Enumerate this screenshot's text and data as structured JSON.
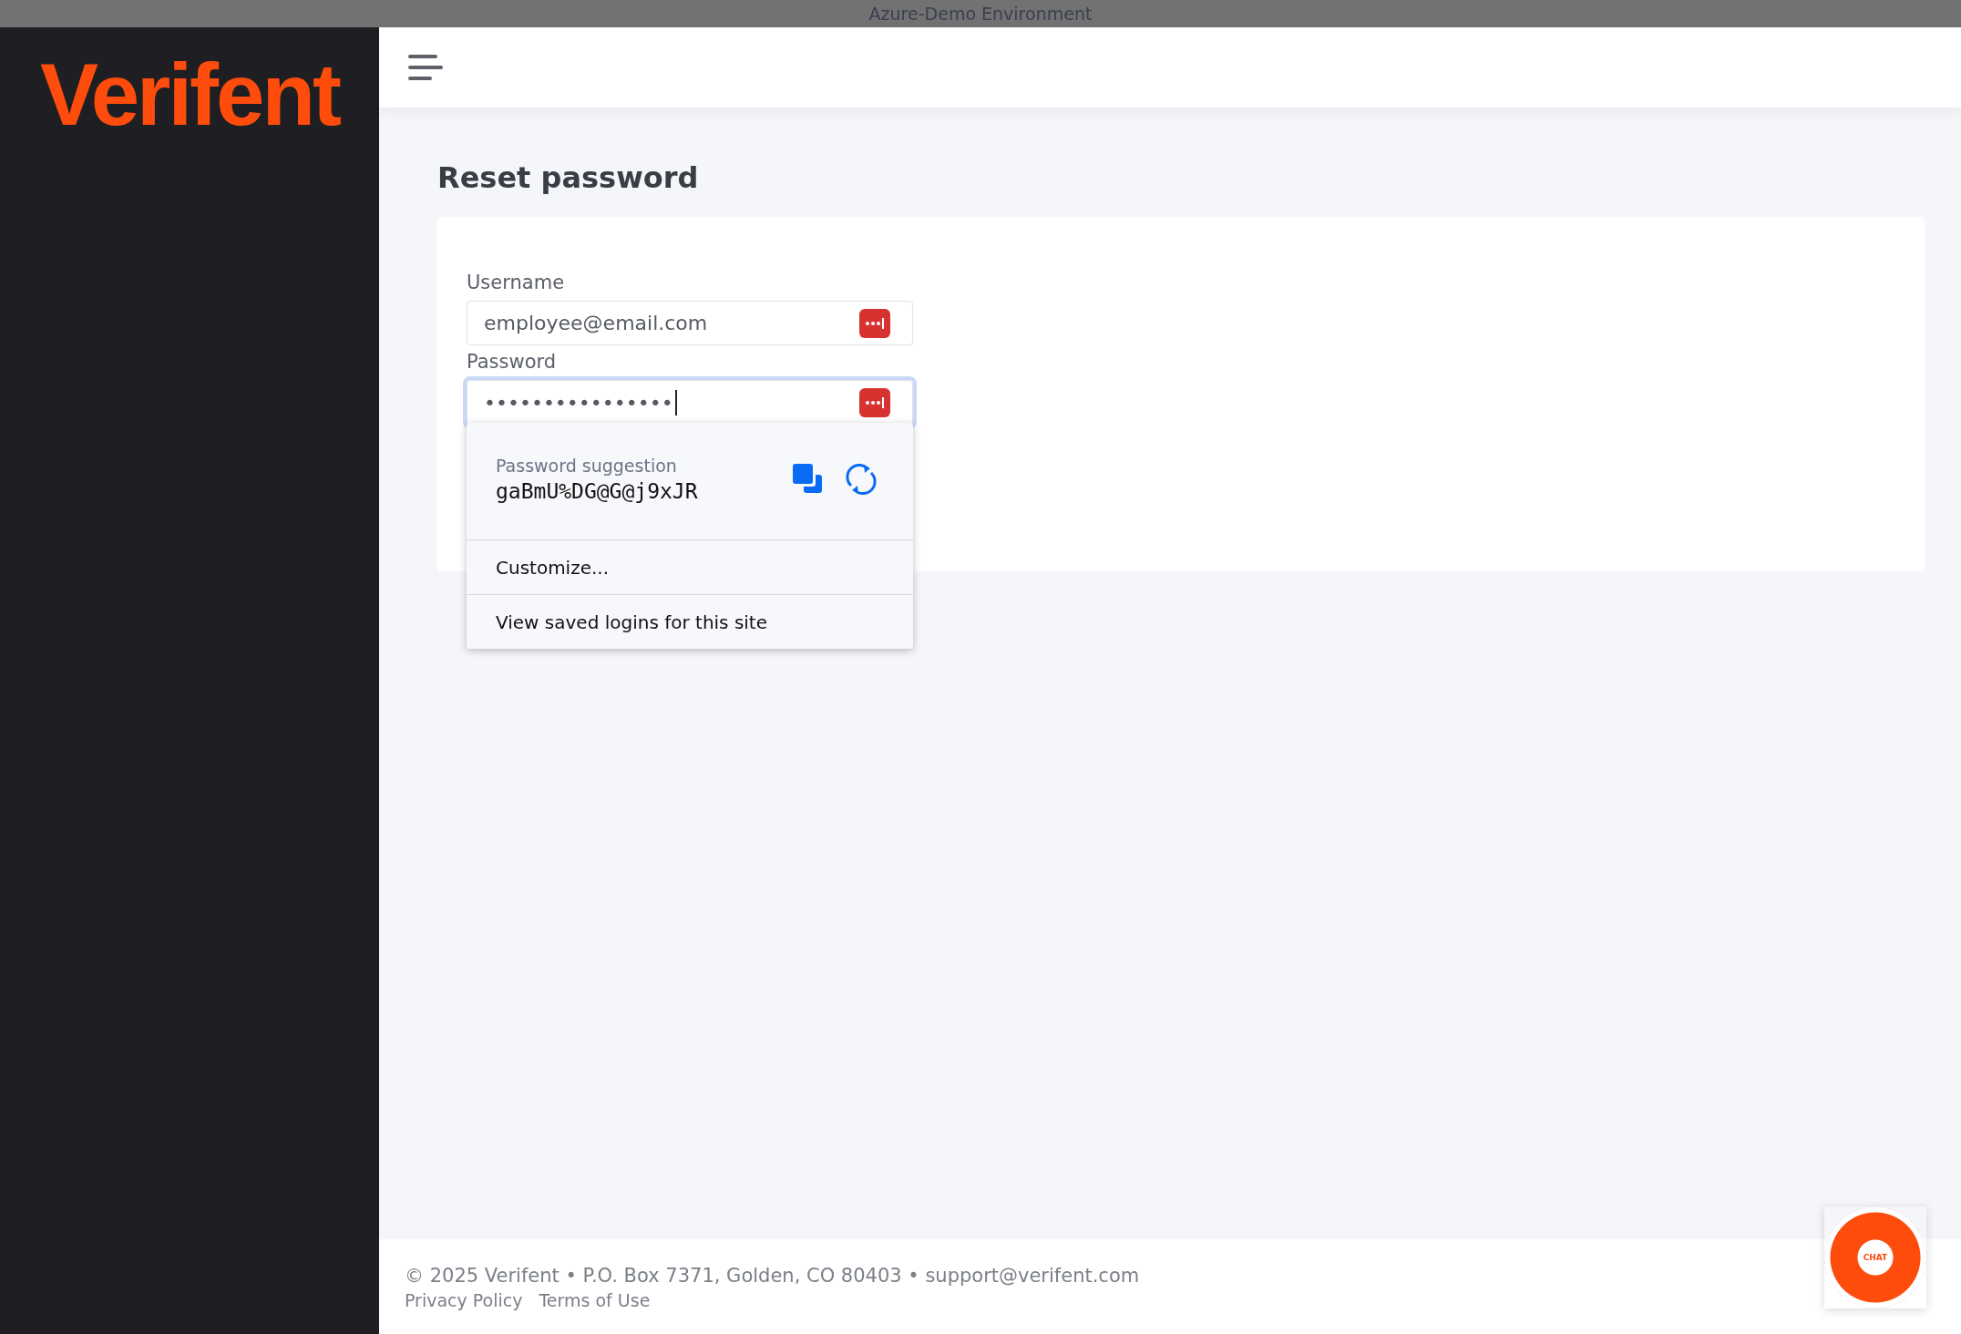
{
  "window": {
    "title": "Azure-Demo Environment"
  },
  "sidebar": {
    "logo": "Verifent"
  },
  "page": {
    "title": "Reset password"
  },
  "form": {
    "fields": [
      {
        "label": "Username",
        "value": "employee@email.com",
        "focused": false
      },
      {
        "label": "Password",
        "value": "••••••••••••••••",
        "focused": true
      }
    ]
  },
  "password_popup": {
    "suggestion_label": "Password suggestion",
    "suggestion": "gaBmU%DG@G@j9xJR",
    "items": [
      "Customize...",
      "View saved logins for this site"
    ]
  },
  "footer": {
    "text": "© 2025 Verifent • P.O. Box 7371, Golden, CO 80403 • support@verifent.com",
    "links": [
      "Privacy Policy",
      "Terms of Use"
    ]
  },
  "chat_button": {
    "label": "CHAT"
  }
}
